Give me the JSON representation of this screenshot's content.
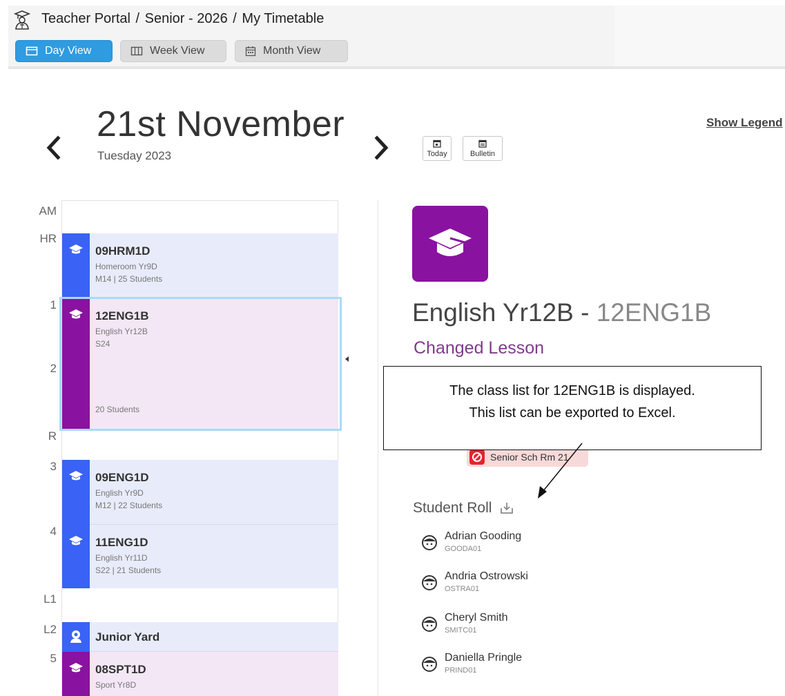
{
  "header": {
    "crumbs": [
      "Teacher Portal",
      "Senior - 2026",
      "My Timetable"
    ],
    "views": [
      {
        "label": "Day View",
        "active": true
      },
      {
        "label": "Week View",
        "active": false
      },
      {
        "label": "Month View",
        "active": false
      }
    ]
  },
  "date_nav": {
    "date": "21st November",
    "weekday_year": "Tuesday 2023",
    "today_label": "Today",
    "bulletin_label": "Bulletin",
    "legend_label": "Show Legend"
  },
  "periods": [
    "AM",
    "HR",
    "1",
    "2",
    "R",
    "3",
    "4",
    "L1",
    "L2",
    "5"
  ],
  "slots": [
    {
      "code": "09HRM1D",
      "desc": "Homeroom Yr9D",
      "meta": "M14 | 25 Students",
      "color": "#3a62f5"
    },
    {
      "code": "12ENG1B",
      "desc": "English Yr12B",
      "meta": "S24",
      "count": "20 Students",
      "color": "#8a12a0",
      "selected": true
    },
    {
      "code": "09ENG1D",
      "desc": "English Yr9D",
      "meta": "M12 | 22 Students",
      "color": "#3a62f5"
    },
    {
      "code": "11ENG1D",
      "desc": "English Yr11D",
      "meta": "S22 | 21 Students",
      "color": "#3a62f5"
    },
    {
      "code": "Junior Yard",
      "icon": "duty-person-icon",
      "color": "#3a62f5"
    },
    {
      "code": "08SPT1D",
      "desc": "Sport Yr8D",
      "color": "#8a12a0"
    }
  ],
  "detail": {
    "title": "English Yr12B - ",
    "title_code": "12ENG1B",
    "status": "Changed Lesson",
    "room": "Senior Sch Rm 21",
    "roll_heading": "Student Roll",
    "students": [
      {
        "name": "Adrian Gooding",
        "id": "GOODA01"
      },
      {
        "name": "Andria Ostrowski",
        "id": "OSTRA01"
      },
      {
        "name": "Cheryl Smith",
        "id": "SMITC01"
      },
      {
        "name": "Daniella Pringle",
        "id": "PRIND01"
      }
    ]
  },
  "callout": {
    "line1": "The class list for 12ENG1B is displayed.",
    "line2": "This list can be exported to Excel."
  },
  "colors": {
    "accent": "#2f9be0",
    "class_purple": "#8a12a0",
    "class_blue": "#3a62f5",
    "room_alert": "#e1262e"
  }
}
